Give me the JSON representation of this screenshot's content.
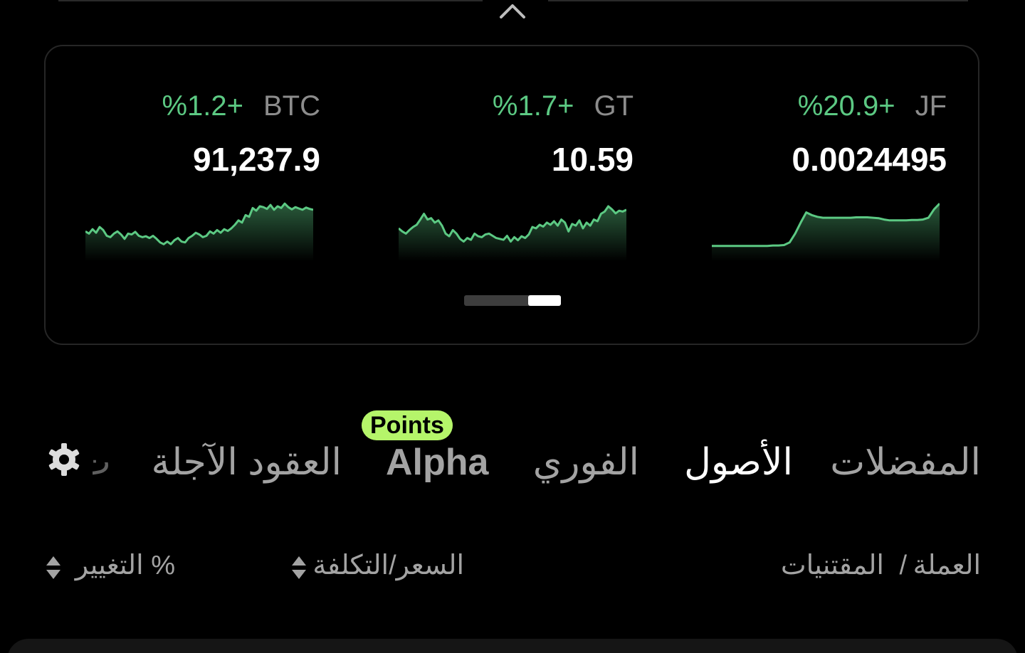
{
  "tickers": [
    {
      "symbol": "BTC",
      "change": "%1.2+",
      "price": "91,237.9",
      "trend": [
        0.35,
        0.3,
        0.4,
        0.32,
        0.45,
        0.38,
        0.25,
        0.22,
        0.3,
        0.35,
        0.28,
        0.18,
        0.3,
        0.28,
        0.34,
        0.25,
        0.22,
        0.24,
        0.2,
        0.25,
        0.18,
        0.1,
        0.06,
        0.12,
        0.06,
        0.15,
        0.2,
        0.12,
        0.1,
        0.2,
        0.25,
        0.32,
        0.28,
        0.22,
        0.25,
        0.35,
        0.3,
        0.38,
        0.32,
        0.4,
        0.36,
        0.42,
        0.5,
        0.6,
        0.55,
        0.72,
        0.68,
        0.88,
        0.82,
        0.92,
        0.9,
        0.86,
        0.95,
        0.84,
        0.92,
        0.88,
        0.98,
        0.9,
        0.85,
        0.9,
        0.87,
        0.84,
        0.89,
        0.86,
        0.84
      ]
    },
    {
      "symbol": "GT",
      "change": "%1.7+",
      "price": "10.59",
      "trend": [
        0.42,
        0.35,
        0.3,
        0.38,
        0.45,
        0.5,
        0.62,
        0.75,
        0.62,
        0.65,
        0.55,
        0.6,
        0.48,
        0.3,
        0.24,
        0.38,
        0.3,
        0.18,
        0.12,
        0.2,
        0.16,
        0.3,
        0.24,
        0.22,
        0.28,
        0.3,
        0.25,
        0.2,
        0.18,
        0.16,
        0.25,
        0.12,
        0.22,
        0.15,
        0.24,
        0.2,
        0.28,
        0.45,
        0.42,
        0.5,
        0.46,
        0.55,
        0.5,
        0.58,
        0.48,
        0.62,
        0.55,
        0.35,
        0.52,
        0.48,
        0.6,
        0.42,
        0.55,
        0.48,
        0.62,
        0.58,
        0.75,
        0.8,
        0.92,
        0.85,
        0.76,
        0.82,
        0.8,
        0.84
      ]
    },
    {
      "symbol": "JF",
      "change": "%20.9+",
      "price": "0.0024495",
      "trend": [
        0.02,
        0.02,
        0.02,
        0.02,
        0.02,
        0.02,
        0.02,
        0.02,
        0.02,
        0.02,
        0.02,
        0.03,
        0.03,
        0.04,
        0.1,
        0.3,
        0.55,
        0.78,
        0.72,
        0.68,
        0.66,
        0.66,
        0.66,
        0.66,
        0.66,
        0.66,
        0.67,
        0.67,
        0.67,
        0.66,
        0.65,
        0.62,
        0.6,
        0.6,
        0.6,
        0.6,
        0.61,
        0.61,
        0.62,
        0.66,
        0.85,
        0.98
      ]
    }
  ],
  "colors": {
    "positive": "#5cc983",
    "badge": "#b5f56a"
  },
  "tabs": {
    "favorites": "المفضلات",
    "assets": "الأصول",
    "spot": "الفوري",
    "alpha": "Alpha",
    "alpha_badge": "Points",
    "futures": "العقود الآجلة",
    "partial": "ت"
  },
  "columns": {
    "coin": "العملة",
    "separator": "/",
    "holdings": "المقتنيات",
    "price_cost": "السعر/التكلفة",
    "change": "التغيير %"
  },
  "icons": {
    "top": "chevron-up-icon",
    "settings": "gear-icon",
    "sort": "sort-icon"
  }
}
